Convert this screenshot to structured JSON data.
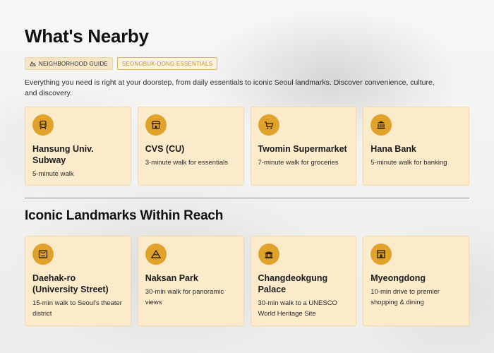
{
  "header": {
    "title": "What's Nearby",
    "tags": [
      {
        "label": "NEIGHBORHOOD GUIDE",
        "icon": "map-icon"
      },
      {
        "label": "SEONGBUK-DONG ESSENTIALS"
      }
    ],
    "intro": "Everything you need is right at your doorstep, from daily essentials to iconic Seoul landmarks. Discover convenience, culture, and discovery."
  },
  "nearby": [
    {
      "title": "Hansung Univ. Subway",
      "desc": "5-minute walk",
      "icon": "subway-icon"
    },
    {
      "title": "CVS (CU)",
      "desc": "3-minute walk for essentials",
      "icon": "store-icon"
    },
    {
      "title": "Twomin Supermarket",
      "desc": "7-minute walk for groceries",
      "icon": "cart-icon"
    },
    {
      "title": "Hana Bank",
      "desc": "5-minute walk for banking",
      "icon": "bank-icon"
    }
  ],
  "landmarks_section": {
    "title": "Iconic Landmarks Within Reach"
  },
  "landmarks": [
    {
      "title": "Daehak-ro (University Street)",
      "desc": "15-min walk to Seoul's theater district",
      "icon": "theater-icon"
    },
    {
      "title": "Naksan Park",
      "desc": "30-min walk for panoramic views",
      "icon": "mountain-icon"
    },
    {
      "title": "Changdeokgung Palace",
      "desc": "30-min walk to a UNESCO World Heritage Site",
      "icon": "palace-icon"
    },
    {
      "title": "Myeongdong",
      "desc": "10-min drive to premier shopping & dining",
      "icon": "shop-icon"
    }
  ],
  "colors": {
    "accent": "#e0a228",
    "card": "#fbebcb",
    "divider": "#8c8c8c"
  }
}
